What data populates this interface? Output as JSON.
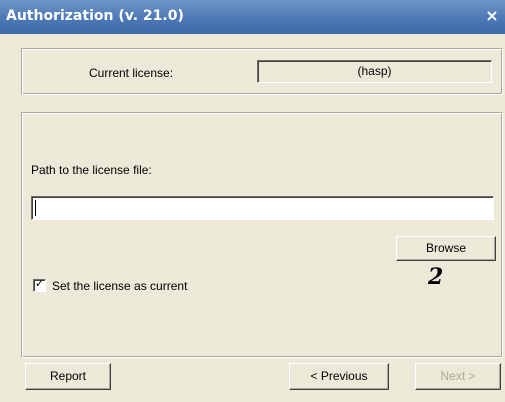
{
  "window": {
    "title": "Authorization (v. 21.0)",
    "close_glyph": "×"
  },
  "license": {
    "current_label": "Current license:",
    "current_value": "(hasp)"
  },
  "path": {
    "label": "Path to the license file:",
    "value": ""
  },
  "browse_label": "Browse",
  "annotation": "2",
  "set_current": {
    "label": "Set the license as current",
    "checked": true,
    "check_glyph": "✓"
  },
  "footer": {
    "report_label": "Report",
    "previous_label": "< Previous",
    "next_label": "Next >"
  },
  "colors": {
    "titlebar": "#4f7bb7",
    "dialog_bg": "#ece9d8"
  }
}
